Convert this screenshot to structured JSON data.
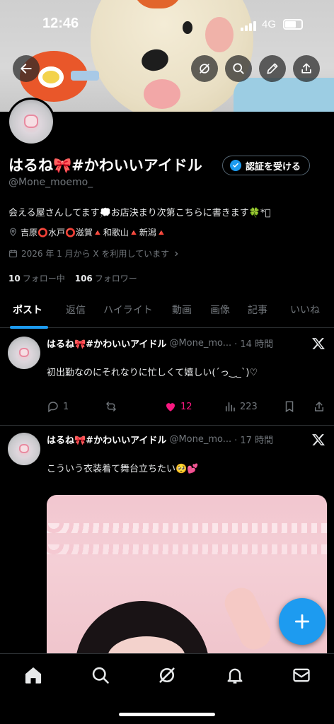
{
  "status_bar": {
    "time": "12:46",
    "network": "4G"
  },
  "profile": {
    "display_name": "はるね🎀#かわいいアイドル",
    "handle": "@Mone_moemo_",
    "verify_button": "認証を受ける",
    "bio": "会える屋さんしてます💭お店決まり次第こちらに書きます🍀*ﾟ",
    "location": "吉原⭕️水戸⭕️滋賀🔺和歌山🔺新潟🔺",
    "joined": "2026 年 1 月から X を利用しています",
    "following_count": "10",
    "following_label": "フォロー中",
    "followers_count": "106",
    "followers_label": "フォロワー"
  },
  "tabs": [
    {
      "label": "ポスト"
    },
    {
      "label": "返信"
    },
    {
      "label": "ハイライト"
    },
    {
      "label": "動画"
    },
    {
      "label": "画像"
    },
    {
      "label": "記事"
    },
    {
      "label": "いいね"
    }
  ],
  "posts": [
    {
      "name": "はるね🎀#かわいいアイドル",
      "handle": "@Mone_mo...",
      "time": "· 14 時間",
      "text": "初出勤なのにそれなりに忙しくて嬉しい(ˊっ‿_ˋ)♡",
      "replies": "1",
      "likes": "12",
      "views": "223"
    },
    {
      "name": "はるね🎀#かわいいアイドル",
      "handle": "@Mone_mo...",
      "time": "· 17 時間",
      "text": "こういう衣装着て舞台立ちたい🥺💕"
    }
  ],
  "icons": {
    "back": "back-arrow-icon",
    "grok": "grok-icon",
    "search": "search-icon",
    "edit": "pencil-icon",
    "share": "share-icon",
    "x_logo": "x-logo-icon",
    "compose": "plus-icon"
  },
  "colors": {
    "accent": "#1d9bf0",
    "like": "#f91880",
    "muted": "#71767b",
    "background": "#000000"
  }
}
